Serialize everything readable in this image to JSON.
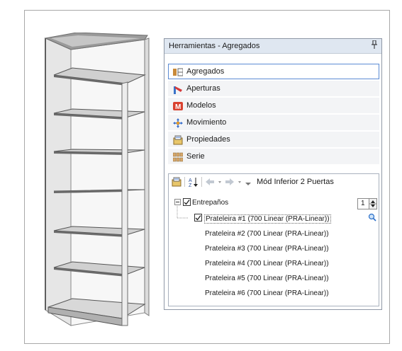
{
  "panel": {
    "title": "Herramientas - Agregados",
    "pin_glyph": "p"
  },
  "nav": [
    {
      "label": "Agregados",
      "icon": "agregados-icon"
    },
    {
      "label": "Aperturas",
      "icon": "aperturas-icon"
    },
    {
      "label": "Modelos",
      "icon": "modelos-icon"
    },
    {
      "label": "Movimiento",
      "icon": "movimiento-icon"
    },
    {
      "label": "Propiedades",
      "icon": "propiedades-icon"
    },
    {
      "label": "Serie",
      "icon": "serie-icon"
    }
  ],
  "toolbar": {
    "breadcrumb": "Mód Inferior 2 Puertas"
  },
  "tree": {
    "root": {
      "label": "Entrepaños",
      "quantity": "1"
    },
    "children": [
      "Prateleira #1 (700 Linear (PRA-Linear))",
      "Prateleira #2 (700 Linear (PRA-Linear))",
      "Prateleira #3 (700 Linear (PRA-Linear))",
      "Prateleira #4 (700 Linear (PRA-Linear))",
      "Prateleira #5 (700 Linear (PRA-Linear))",
      "Prateleira #6 (700 Linear (PRA-Linear))"
    ]
  },
  "colors": {
    "title_bg": "#dfe7f1",
    "selected_border": "#5b8bd4",
    "nav_bg": "#f3f4f6"
  }
}
